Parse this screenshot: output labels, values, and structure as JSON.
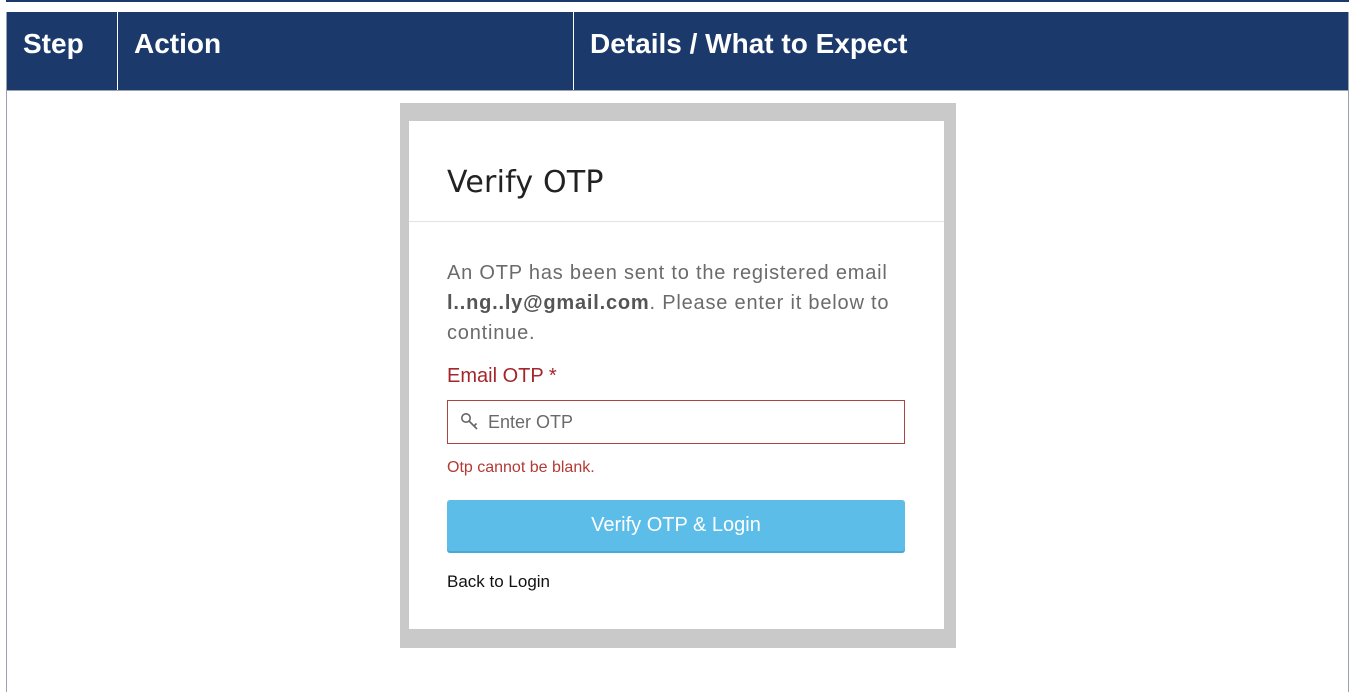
{
  "table": {
    "headers": [
      "Step",
      "Action",
      "Details / What to Expect"
    ]
  },
  "screenshot": {
    "title": "Verify OTP",
    "message_before": "An OTP has been sent to the registered email ",
    "masked_email": "l..ng..ly@gmail.com",
    "message_after": ". Please enter it below to continue.",
    "field_label": "Email OTP *",
    "otp_input": {
      "value": "",
      "placeholder": "Enter OTP"
    },
    "error": "Otp cannot be blank.",
    "verify_button": "Verify OTP & Login",
    "back_link": "Back to Login"
  },
  "colors": {
    "header_bg": "#1b3a6b",
    "error": "#a3262b",
    "button": "#5bbde8"
  },
  "icons": {
    "input_icon": "key-icon"
  }
}
